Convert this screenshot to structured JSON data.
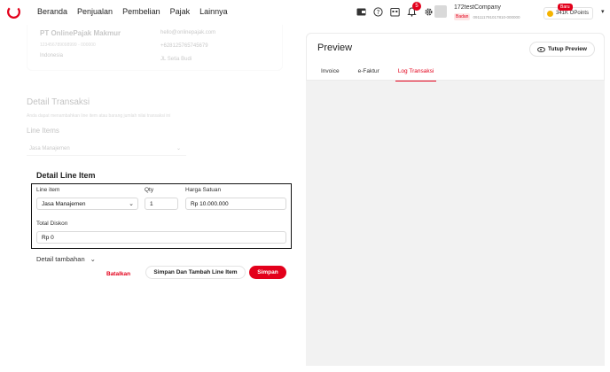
{
  "nav": {
    "menu": [
      "Beranda",
      "Penjualan",
      "Pembelian",
      "Pajak",
      "Lainnya"
    ],
    "notif_count": "5",
    "company_name": "172testCompany",
    "company_type": "Badan",
    "company_npwp": "091111791017810-000000",
    "baru_label": "Baru",
    "points_label": "341K OPoints",
    "icons": [
      "wallet-icon",
      "help-icon",
      "calendar-icon",
      "bell-icon",
      "gear-icon"
    ]
  },
  "company": {
    "name": "PT OnlinePajak Makmur",
    "npwp": "123456789098999 - 000000",
    "country": "Indonesia",
    "email": "hello@onlinepajak.com",
    "phone": "+628125765745679",
    "address": "JL Setia Budi"
  },
  "detail_transaksi": {
    "title": "Detail Transaksi",
    "subtitle": "Anda dapat menambahkan line item atau barang jumlah nilai transaksi ini",
    "line_items_title": "Line Items",
    "jasa_value": "Jasa Manajemen"
  },
  "detail_line_item": {
    "title": "Detail Line Item",
    "line_item_label": "Line item",
    "line_item_value": "Jasa Manajemen",
    "qty_label": "Qty",
    "qty_value": "1",
    "harga_label": "Harga Satuan",
    "harga_value": "Rp 10.000.000",
    "diskon_label": "Total Diskon",
    "diskon_value": "Rp 0"
  },
  "detail_tambahan": "Detail tambahan",
  "buttons": {
    "batalkan": "Batalkan",
    "simpan_tambah": "Simpan Dan Tambah Line Item",
    "simpan": "Simpan"
  },
  "preview": {
    "title": "Preview",
    "tutup_label": "Tutup Preview",
    "tabs": [
      "Invoice",
      "e-Faktur",
      "Log Transaksi"
    ],
    "active_tab": "Log Transaksi"
  },
  "colors": {
    "accent": "#e3001b"
  }
}
